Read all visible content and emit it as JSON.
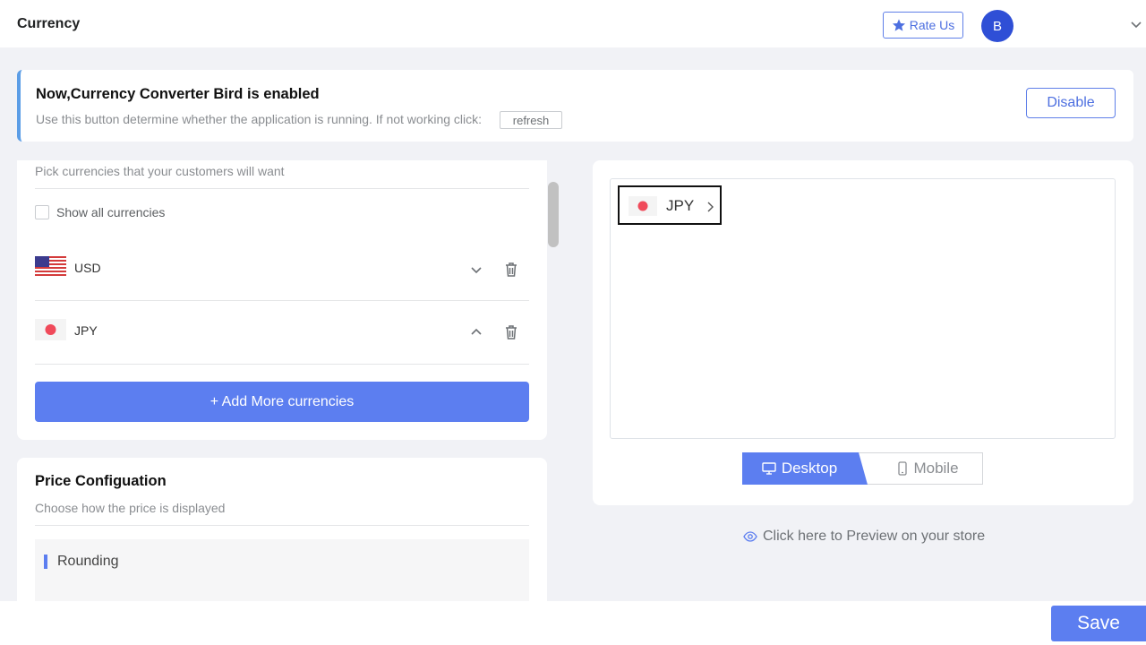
{
  "header": {
    "title": "Currency",
    "rate_label": "Rate Us",
    "avatar_initial": "B"
  },
  "status": {
    "title": "Now,Currency Converter Bird is enabled",
    "description": "Use this button determine whether the application is running.  If not working click:",
    "refresh_label": "refresh",
    "disable_label": "Disable"
  },
  "currencies": {
    "pick_label": "Pick currencies that your customers will want",
    "show_all_label": "Show all currencies",
    "show_all_checked": false,
    "items": [
      {
        "code": "USD",
        "flag": "us-flag",
        "expanded": false
      },
      {
        "code": "JPY",
        "flag": "japan-flag",
        "expanded": true
      }
    ],
    "add_label": "+ Add More currencies"
  },
  "price_config": {
    "title": "Price Configuation",
    "description": "Choose how the price is displayed",
    "rounding_label": "Rounding"
  },
  "preview": {
    "switcher_code": "JPY",
    "desktop_label": "Desktop",
    "mobile_label": "Mobile",
    "active_view": "desktop",
    "store_link_label": "Click here to Preview on your store"
  },
  "footer": {
    "save_label": "Save"
  },
  "colors": {
    "accent": "#5c7ef0",
    "avatar": "#2f4fd6",
    "status_border": "#5b9de6",
    "japan_dot": "#f04a5a"
  }
}
